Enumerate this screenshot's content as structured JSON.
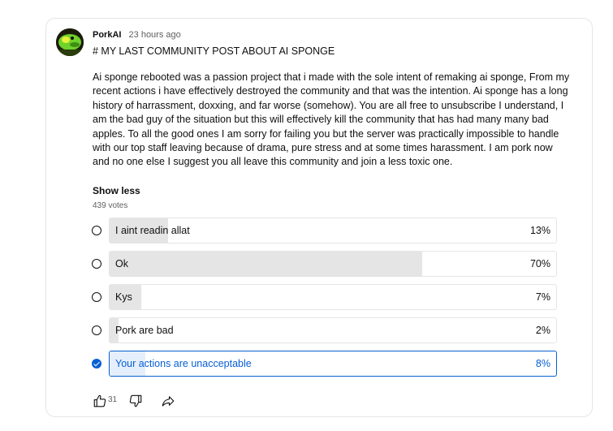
{
  "post": {
    "author": "PorkAI",
    "time": "23 hours ago",
    "title": "# MY LAST COMMUNITY POST ABOUT AI SPONGE",
    "body": "Ai sponge rebooted was a passion project that i made with the sole intent of remaking ai sponge, From my recent actions i have effectively destroyed the community and that was the intention. Ai sponge has a long history of harrassment, doxxing, and far worse (somehow). You are all free to unsubscribe I understand, I am the bad guy of the situation but this will effectively kill the community that has had many many bad apples. To all the good ones I am sorry for failing you but the server was practically impossible to handle with our top staff leaving because of drama, pure stress and at some times harassment. I am pork now and no one else I suggest you all leave this community and join a less toxic one.",
    "show_less": "Show less",
    "votes": "439 votes"
  },
  "poll": {
    "options": [
      {
        "label": "I aint readin allat",
        "percent": "13%",
        "fill": 0.13,
        "selected": false
      },
      {
        "label": "Ok",
        "percent": "70%",
        "fill": 0.7,
        "selected": false
      },
      {
        "label": "Kys",
        "percent": "7%",
        "fill": 0.07,
        "selected": false
      },
      {
        "label": "Pork are bad",
        "percent": "2%",
        "fill": 0.02,
        "selected": false
      },
      {
        "label": "Your actions are unacceptable",
        "percent": "8%",
        "fill": 0.08,
        "selected": true
      }
    ]
  },
  "actions": {
    "like_count": "31",
    "like_icon": "thumbs-up-icon",
    "dislike_icon": "thumbs-down-icon",
    "share_icon": "share-icon"
  },
  "colors": {
    "accent": "#065fd4",
    "bar_fill": "#e5e5e5",
    "selected_fill": "#e5effb"
  }
}
